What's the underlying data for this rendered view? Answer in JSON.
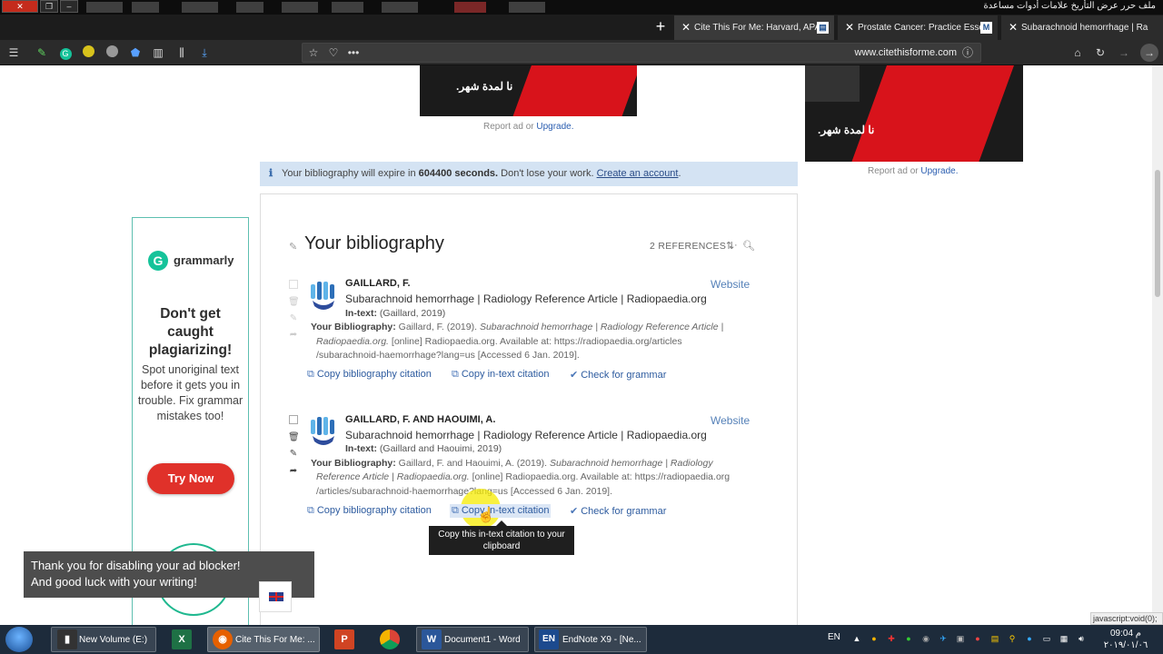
{
  "browser": {
    "menu_arabic": "ملف  حرر  عرض  التأريخ  علامات  أدوات  مساعدة",
    "tabs": [
      {
        "label": "Cite This For Me: Harvard, APA",
        "active": true
      },
      {
        "label": "Prostate Cancer: Practice Essen",
        "active": false
      },
      {
        "label": "Subarachnoid hemorrhage | Ra",
        "active": false
      }
    ],
    "url": "www.citethisforme.com",
    "status_url": "javascript:void(0);"
  },
  "ads": {
    "arabic_text": "نا لمدة شهر.",
    "report_prefix": "Report ad or",
    "upgrade_label": "Upgrade."
  },
  "expire_banner": {
    "prefix": "Your bibliography will expire in",
    "seconds": "604400 seconds.",
    "middle": "Don't lose your work.",
    "link": "Create an account"
  },
  "bibliography": {
    "title": "Your bibliography",
    "ref_count": "2 REFERENCES ·",
    "references": [
      {
        "author": "GAILLARD, F.",
        "title": "Subarachnoid hemorrhage | Radiology Reference Article | Radiopaedia.org",
        "intext_label": "In-text:",
        "intext": "(Gaillard, 2019)",
        "source_type": "Website",
        "bib_label": "Your Bibliography:",
        "bib_line1_plain": "Gaillard, F. (2019).",
        "bib_line1_italic": "Subarachnoid hemorrhage | Radiology Reference Article |",
        "bib_line2_italic": "Radiopaedia.org.",
        "bib_line2_plain": "[online] Radiopaedia.org. Available at: https://radiopaedia.org/articles",
        "bib_line3": "/subarachnoid-haemorrhage?lang=us [Accessed 6 Jan. 2019]."
      },
      {
        "author": "GAILLARD, F. AND HAOUIMI, A.",
        "title": "Subarachnoid hemorrhage | Radiology Reference Article | Radiopaedia.org",
        "intext_label": "In-text:",
        "intext": "(Gaillard and Haouimi, 2019)",
        "source_type": "Website",
        "bib_label": "Your Bibliography:",
        "bib_line1_plain": "Gaillard, F. and Haouimi, A. (2019).",
        "bib_line1_italic": "Subarachnoid hemorrhage | Radiology",
        "bib_line2_italic": "Reference Article | Radiopaedia.org.",
        "bib_line2_plain": "[online] Radiopaedia.org. Available at: https://radiopaedia.org",
        "bib_line3": "/articles/subarachnoid-haemorrhage?lang=us [Accessed 6 Jan. 2019]."
      }
    ],
    "actions": {
      "copy_bib": "Copy bibliography citation",
      "copy_intext": "Copy in-text citation",
      "grammar": "Check for grammar"
    },
    "tooltip": "Copy this in-text citation to your clipboard"
  },
  "grammarly_ad": {
    "brand": "grammarly",
    "headline": "Don't get caught plagiarizing!",
    "body": "Spot unoriginal text before it gets you in trouble. Fix grammar mistakes too!",
    "button": "Try Now"
  },
  "toast": {
    "line1": "Thank you for disabling your ad blocker!",
    "line2": "And good luck with your writing!"
  },
  "taskbar": {
    "items": [
      {
        "label": "New Volume (E:)"
      },
      {
        "label": "Cite This For Me: ..."
      },
      {
        "label": "Document1 - Word"
      },
      {
        "label": "EndNote X9 - [Ne..."
      }
    ],
    "lang": "EN",
    "time": "09:04 م",
    "date": "٢٠١٩/٠١/٠٦"
  },
  "colors": {
    "accent_blue": "#2d5b9f",
    "banner_bg": "#d4e3f3",
    "grammarly_green": "#15c39a",
    "try_now_red": "#e0312a",
    "ad_red": "#d8131b"
  }
}
